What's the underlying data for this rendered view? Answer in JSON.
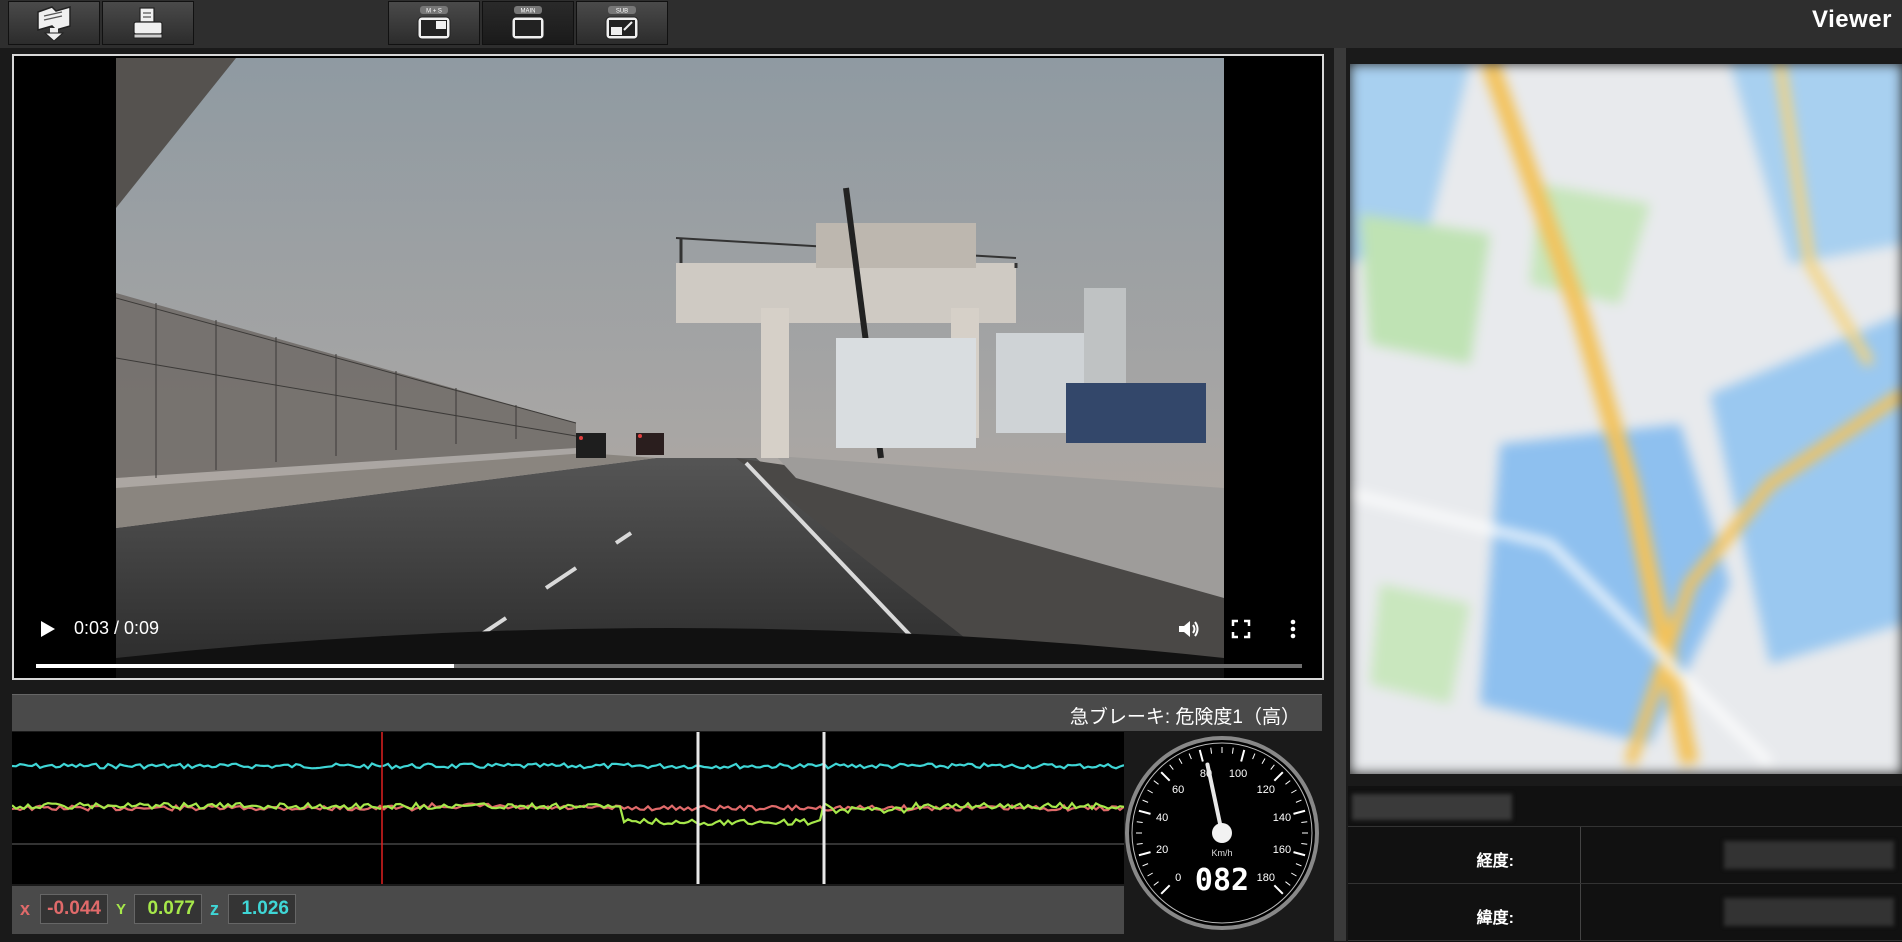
{
  "app": {
    "title": "Viewer"
  },
  "toolbar": {
    "buttons": [
      {
        "name": "open-folder-button",
        "icon": "folder-download-icon"
      },
      {
        "name": "print-button",
        "icon": "printer-icon"
      },
      {
        "name": "view-ms-button",
        "label": "M + S",
        "icon": "main-sub-layout-icon"
      },
      {
        "name": "view-main-button",
        "label": "MAIN",
        "icon": "main-layout-icon",
        "active": true
      },
      {
        "name": "view-sub-button",
        "label": "SUB",
        "icon": "sub-layout-icon"
      }
    ]
  },
  "video": {
    "time": "0:03 / 0:09",
    "progress_fraction": 0.33,
    "controls": [
      "play-icon",
      "volume-icon",
      "fullscreen-icon",
      "more-vert-icon"
    ]
  },
  "event": {
    "text": "急ブレーキ: 危険度1（高）"
  },
  "accel": {
    "x_label": "x",
    "x_value": "-0.044",
    "y_label": "Y",
    "y_value": "0.077",
    "z_label": "z",
    "z_value": "1.026",
    "colors": {
      "x": "#e06a6a",
      "y": "#a6e84a",
      "z": "#3fd6d6"
    }
  },
  "speedometer": {
    "unit": "Km/h",
    "digital": "082",
    "speed": 82,
    "max": 180,
    "ticks": [
      "0",
      "20",
      "40",
      "60",
      "80",
      "100",
      "120",
      "140",
      "160",
      "180"
    ]
  },
  "coords": {
    "longitude_label": "経度:",
    "latitude_label": "緯度:"
  }
}
